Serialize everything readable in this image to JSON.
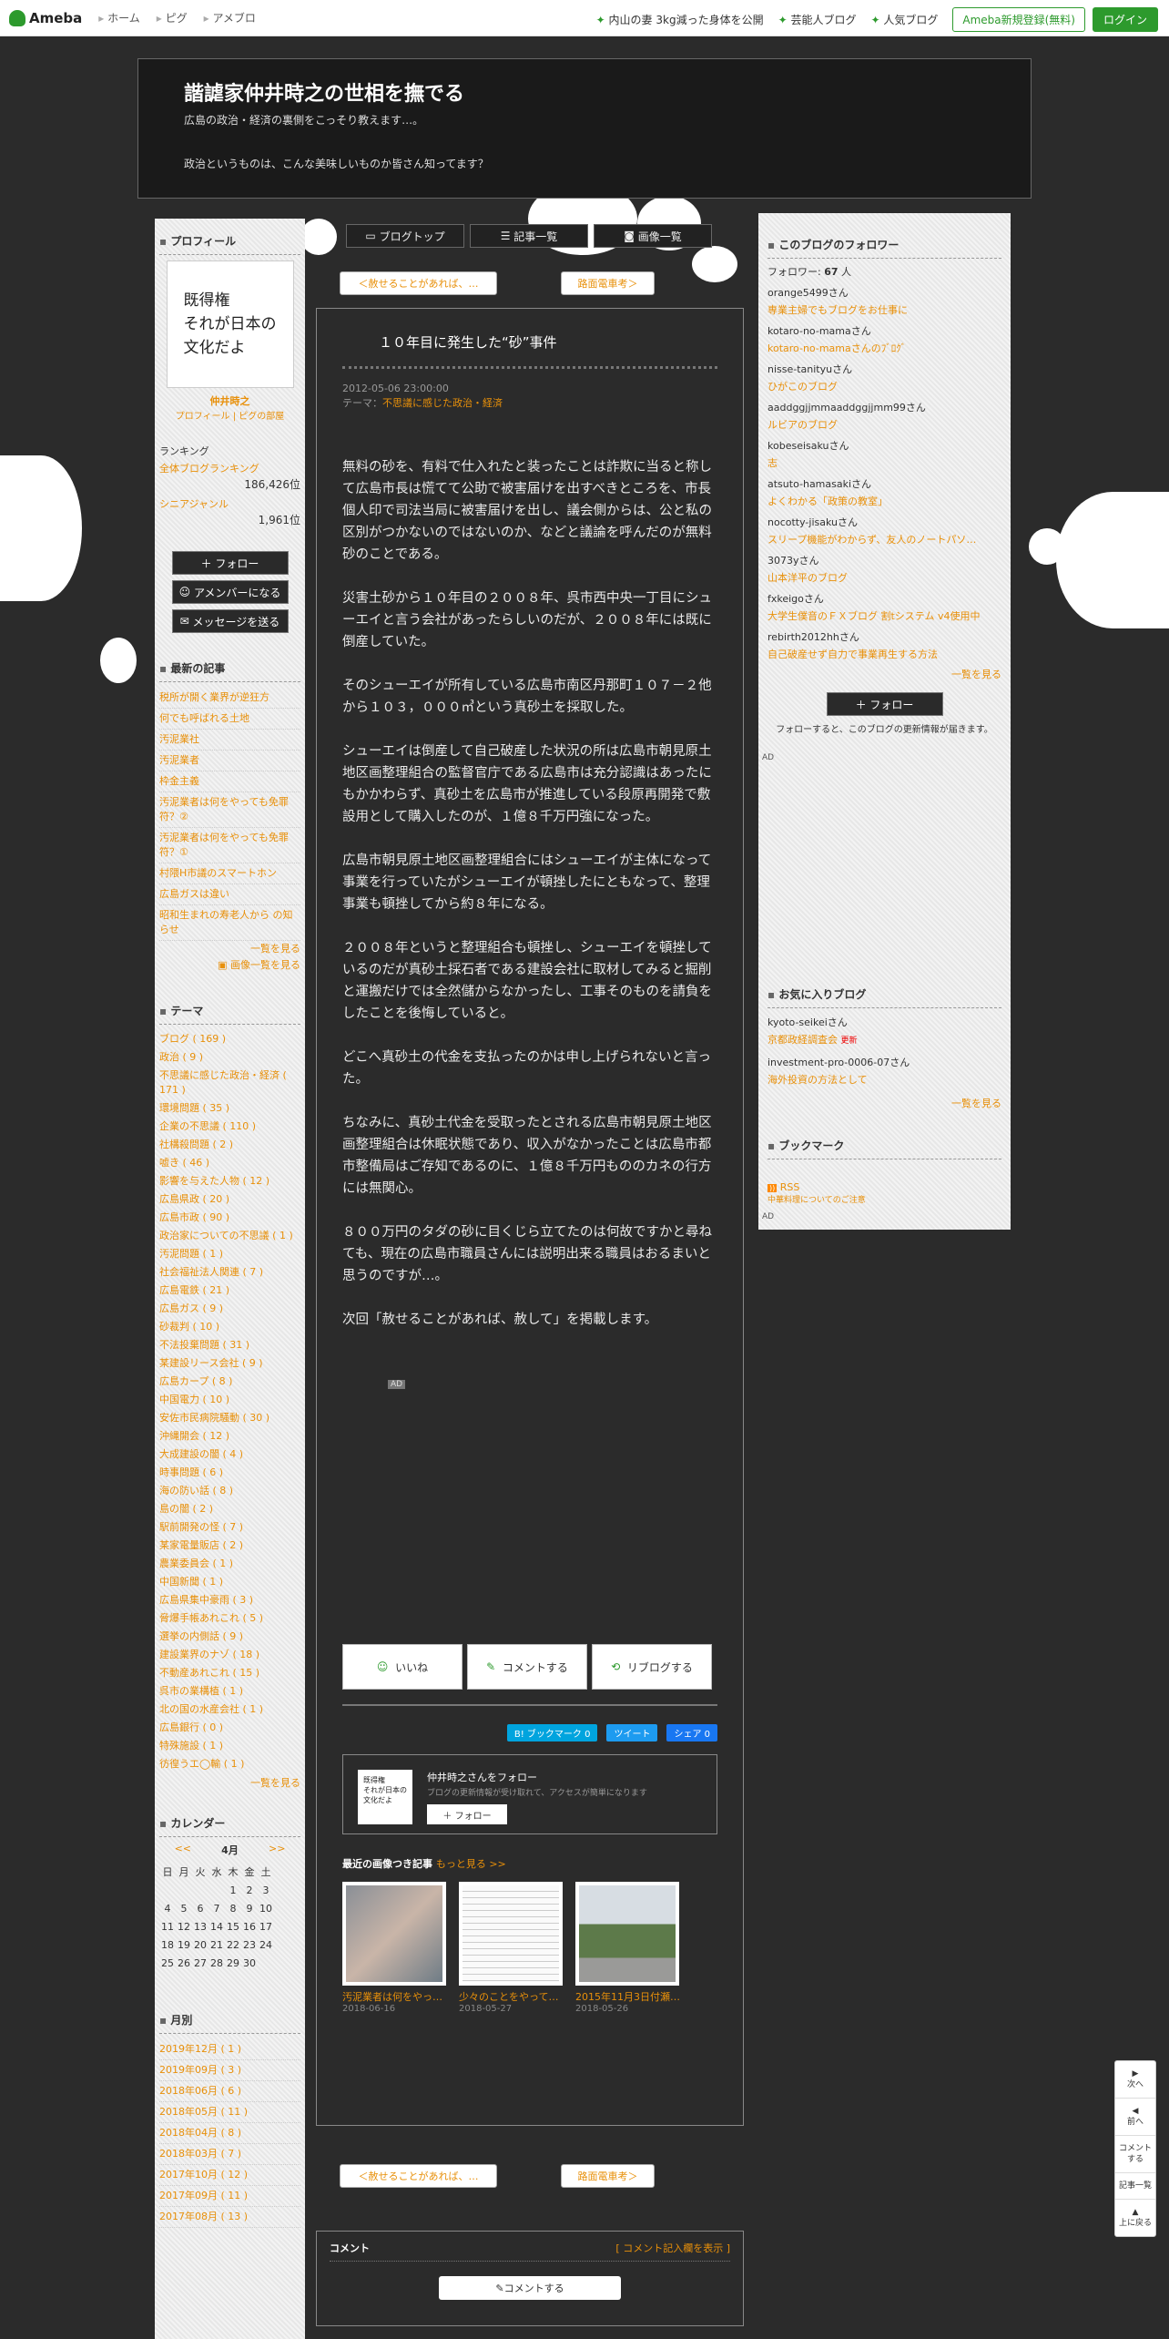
{
  "topbar": {
    "logo": "Ameba",
    "nav": [
      "ホーム",
      "ピグ",
      "アメブロ"
    ],
    "links": [
      "内山の妻 3kg減った身体を公開",
      "芸能人ブログ",
      "人気ブログ"
    ],
    "register": "Ameba新規登録(無料)",
    "login": "ログイン"
  },
  "header": {
    "title": "諧謔家仲井時之の世相を撫でる",
    "desc": "広島の政治・経済の裏側をこっそり教えます…。",
    "desc2": "政治というものは、こんな美味しいものか皆さん知ってます？"
  },
  "tabs": [
    "ブログトップ",
    "記事一覧",
    "画像一覧"
  ],
  "pager": {
    "prev": "＜赦せることがあれば、…",
    "next": "路面電車考＞"
  },
  "profile": {
    "heading": "プロフィール",
    "image_text": "既得権\nそれが日本の\n文化だよ",
    "name": "仲井時之",
    "links": "プロフィール | ピグの部屋",
    "rank_heading": "ランキング",
    "rank1_label": "全体ブログランキング",
    "rank1_value": "186,426位",
    "rank2_label": "シニアジャンル",
    "rank2_value": "1,961位",
    "buttons": [
      "フォロー",
      "アメンバーになる",
      "メッセージを送る"
    ]
  },
  "recent": {
    "heading": "最新の記事",
    "items": [
      "税所が開く業界が逆狂方",
      "何でも呼ばれる土地",
      "汚泥業社",
      "汚泥業者",
      "枠金主義",
      "汚泥業者は何をやっても免罪符？②",
      "汚泥業者は何をやっても免罪符？①",
      "村隈H市議のスマートホン",
      "広島ガスは違い",
      "昭和生まれの寿老人から の知らせ"
    ],
    "more": "一覧を見る",
    "more2": "画像一覧を見る"
  },
  "themes": {
    "heading": "テーマ",
    "items": [
      "ブログ ( 169 )",
      "政治 ( 9 )",
      "不思議に感じた政治・経済 ( 171 )",
      "環境問題 ( 35 )",
      "企業の不思議 ( 110 )",
      "社構殺問題 ( 2 )",
      "嘘き ( 46 )",
      "影響を与えた人物 ( 12 )",
      "広島県政 ( 20 )",
      "広島市政 ( 90 )",
      "政治家についての不思議 ( 1 )",
      "汚泥問題 ( 1 )",
      "社会福祉法人関連 ( 7 )",
      "広島電鉄 ( 21 )",
      "広島ガス ( 9 )",
      "砂裁判 ( 10 )",
      "不法投棄問題 ( 31 )",
      "某建設リース会社 ( 9 )",
      "広島カープ ( 8 )",
      "中国電力 ( 10 )",
      "安佐市民病院騒動 ( 30 )",
      "沖縄開会 ( 12 )",
      "大成建設の闇 ( 4 )",
      "時事問題 ( 6 )",
      "海の防い話 ( 8 )",
      "島の闇 ( 2 )",
      "駅前開発の怪 ( 7 )",
      "某家電量販店 ( 2 )",
      "農業委員会 ( 1 )",
      "中国新聞 ( 1 )",
      "広島県集中豪雨 ( 3 )",
      "脅爆手帳あれこれ ( 5 )",
      "選挙の内側話 ( 9 )",
      "建設業界のナゾ ( 18 )",
      "不動産あれこれ ( 15 )",
      "呉市の業構植 ( 1 )",
      "北の国の水産会社 ( 1 )",
      "広島銀行 ( 0 )",
      "特殊施設 ( 1 )",
      "彷徨うエ◯輸 ( 1 )"
    ],
    "more": "一覧を見る"
  },
  "calendar": {
    "heading": "カレンダー",
    "prev": "<<",
    "month": "4月",
    "next": ">>",
    "dow": [
      "日",
      "月",
      "火",
      "水",
      "木",
      "金",
      "土"
    ],
    "weeks": [
      [
        "",
        "",
        "",
        "",
        "1",
        "2",
        "3"
      ],
      [
        "4",
        "5",
        "6",
        "7",
        "8",
        "9",
        "10"
      ],
      [
        "11",
        "12",
        "13",
        "14",
        "15",
        "16",
        "17"
      ],
      [
        "18",
        "19",
        "20",
        "21",
        "22",
        "23",
        "24"
      ],
      [
        "25",
        "26",
        "27",
        "28",
        "29",
        "30",
        ""
      ]
    ]
  },
  "monthly": {
    "heading": "月別",
    "items": [
      "2019年12月 ( 1 )",
      "2019年09月 ( 3 )",
      "2018年06月 ( 6 )",
      "2018年05月 ( 11 )",
      "2018年04月 ( 8 )",
      "2018年03月 ( 7 )",
      "2017年10月 ( 12 )",
      "2017年09月 ( 11 )",
      "2017年08月 ( 13 )"
    ]
  },
  "entry": {
    "title": "１０年目に発生した“砂”事件",
    "date": "2012-05-06 23:00:00",
    "theme_label": "テーマ：",
    "theme": "不思議に感じた政治・経済",
    "paragraphs": [
      "無料の砂を、有料で仕入れたと装ったことは詐欺に当ると称して広島市長は慌てて公助で被害届けを出すべきところを、市長個人印で司法当局に被害届けを出し、議会側からは、公と私の区別がつかないのではないのか、などと議論を呼んだのが無料砂のことである。",
      "災害土砂から１０年目の２００８年、呉市西中央一丁目にシューエイと言う会社があったらしいのだが、２００８年には既に倒産していた。",
      "そのシューエイが所有している広島市南区丹那町１０７－２他から１０３，０００㎥という真砂土を採取した。",
      "シューエイは倒産して自己破産した状況の所は広島市朝見原土地区画整理組合の監督官庁である広島市は充分認識はあったにもかかわらず、真砂土を広島市が推進している段原再開発で敷設用として購入したのが、１億８千万円強になった。",
      "広島市朝見原土地区画整理組合にはシューエイが主体になって事業を行っていたがシューエイが頓挫したにともなって、整理事業も頓挫してから約８年になる。",
      "２００８年というと整理組合も頓挫し、シューエイを頓挫しているのだが真砂土採石者である建設会社に取材してみると掘削と運搬だけでは全然儲からなかったし、工事そのものを請負をしたことを後悔していると。",
      "どこへ真砂土の代金を支払ったのかは申し上げられないと言った。",
      "ちなみに、真砂土代金を受取ったとされる広島市朝見原土地区画整理組合は休眠状態であり、収入がなかったことは広島市都市整備局はご存知であるのに、１億８千万円もののカネの行方には無関心。",
      "８００万円のタダの砂に目くじら立てたのは何故ですかと尋ねても、現在の広島市職員さんには説明出来る職員はおるまいと思うのですが…。",
      "",
      "次回「赦せることがあれば、赦して」を掲載します。"
    ],
    "ad": "AD",
    "actions": [
      "いいね",
      "コメントする",
      "リブログする"
    ],
    "share": [
      "B! ブックマーク 0",
      "ツイート",
      "シェア 0"
    ],
    "follow": {
      "name": "仲井時之さんをフォロー",
      "desc": "ブログの更新情報が受け取れて、アクセスが簡単になります",
      "button": "＋ フォロー",
      "thumb_text": "既得権\nそれが日本の\n文化だよ"
    },
    "images_heading": "最近の画像つき記事",
    "images_more": "もっと見る >>",
    "images": [
      {
        "cap": "汚泥業者は何をやっ…",
        "date": "2018-06-16"
      },
      {
        "cap": "少々のことをやって…",
        "date": "2018-05-27"
      },
      {
        "cap": "2015年11月3日付瀬…",
        "date": "2018-05-26"
      }
    ]
  },
  "comment": {
    "heading": "コメント",
    "show": "[ コメント記入欄を表示 ]",
    "button": "コメントする"
  },
  "followers": {
    "heading": "このブログのフォロワー",
    "count_label": "フォロワー:",
    "count": "67",
    "unit": "人",
    "items": [
      {
        "n": "orange5499さん",
        "b": "専業主婦でもブログをお仕事に"
      },
      {
        "n": "kotaro-no-mamaさん",
        "b": "kotaro-no-mamaさんのﾌﾞﾛｸﾞ"
      },
      {
        "n": "nisse-tanityuさん",
        "b": "ひがこのブログ"
      },
      {
        "n": "aaddggjjmmaaddggjjmm99さん",
        "b": "ルビアのブログ"
      },
      {
        "n": "kobeseisakuさん",
        "b": "志"
      },
      {
        "n": "atsuto-hamasakiさん",
        "b": "よくわかる「政策の教室」"
      },
      {
        "n": "nocotty-jisakuさん",
        "b": "スリープ機能がわからず、友人のノートパソ…"
      },
      {
        "n": "3073yさん",
        "b": "山本洋平のブログ"
      },
      {
        "n": "fxkeigoさん",
        "b": "大学生僕音のＦＸブログ 割tシステム v4使用中"
      },
      {
        "n": "rebirth2012hhさん",
        "b": "自己破産せず自力で事業再生する方法"
      }
    ],
    "more": "一覧を見る",
    "button": "フォロー",
    "note": "フォローすると、このブログの更新情報が届きます。",
    "ad": "AD"
  },
  "favorites": {
    "heading": "お気に入りブログ",
    "items": [
      {
        "n": "kyoto-seikeiさん",
        "b": "京都政経調査会",
        "new": "更新"
      },
      {
        "n": "investment-pro-0006-07さん",
        "b": "海外投資の方法として",
        "new": ""
      }
    ],
    "more": "一覧を見る"
  },
  "bookmark": {
    "heading": "ブックマーク",
    "rss": "RSS",
    "link": "中華料理についてのご注意",
    "ad": "AD"
  },
  "sidenav": [
    "次へ",
    "前へ",
    "コメントする",
    "記事一覧",
    "上に戻る"
  ]
}
